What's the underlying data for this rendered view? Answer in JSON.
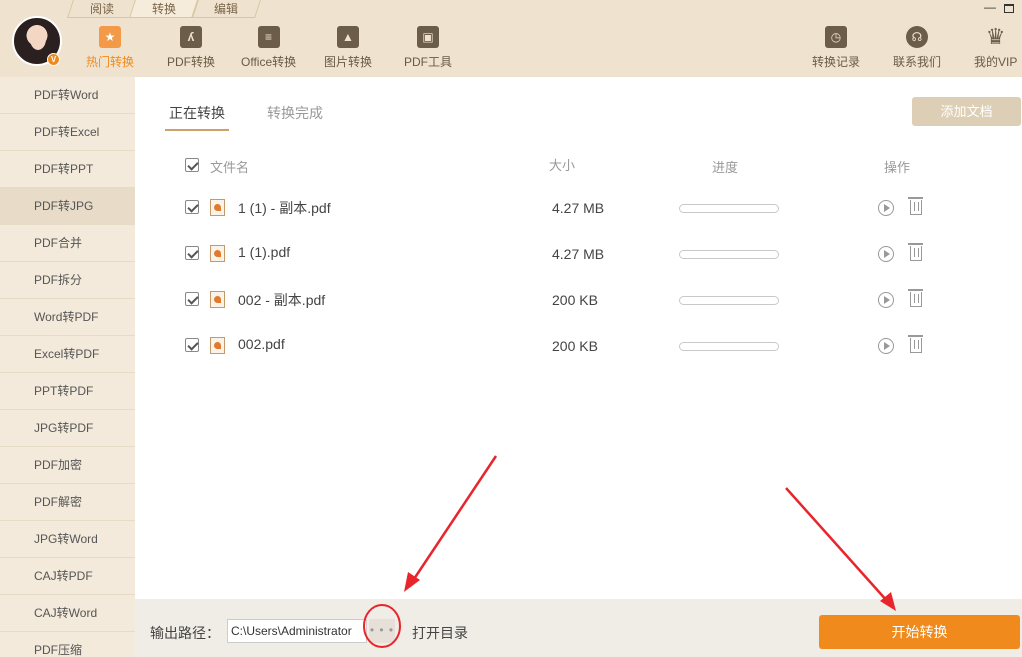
{
  "mode_tabs": [
    {
      "label": "阅读",
      "active": false
    },
    {
      "label": "转换",
      "active": true
    },
    {
      "label": "编辑",
      "active": false
    }
  ],
  "window_controls": {
    "minimize": "—",
    "maximize": ""
  },
  "avatar": {
    "badge": "V"
  },
  "toolbar": {
    "left": [
      {
        "label": "热门转换",
        "icon": "star-icon",
        "active": true
      },
      {
        "label": "PDF转换",
        "icon": "pdf-icon",
        "active": false
      },
      {
        "label": "Office转换",
        "icon": "office-doc-icon",
        "active": false
      },
      {
        "label": "图片转换",
        "icon": "image-icon",
        "active": false
      },
      {
        "label": "PDF工具",
        "icon": "toolbox-icon",
        "active": false
      }
    ],
    "right": [
      {
        "label": "转换记录",
        "icon": "clock-icon"
      },
      {
        "label": "联系我们",
        "icon": "headset-icon"
      },
      {
        "label": "我的VIP",
        "icon": "crown-icon"
      }
    ]
  },
  "sidebar": {
    "items": [
      {
        "label": "PDF转Word",
        "active": false
      },
      {
        "label": "PDF转Excel",
        "active": false
      },
      {
        "label": "PDF转PPT",
        "active": false
      },
      {
        "label": "PDF转JPG",
        "active": true
      },
      {
        "label": "PDF合并",
        "active": false
      },
      {
        "label": "PDF拆分",
        "active": false
      },
      {
        "label": "Word转PDF",
        "active": false
      },
      {
        "label": "Excel转PDF",
        "active": false
      },
      {
        "label": "PPT转PDF",
        "active": false
      },
      {
        "label": "JPG转PDF",
        "active": false
      },
      {
        "label": "PDF加密",
        "active": false
      },
      {
        "label": "PDF解密",
        "active": false
      },
      {
        "label": "JPG转Word",
        "active": false
      },
      {
        "label": "CAJ转PDF",
        "active": false
      },
      {
        "label": "CAJ转Word",
        "active": false
      },
      {
        "label": "PDF压缩",
        "active": false
      }
    ]
  },
  "main": {
    "tabs": [
      {
        "label": "正在转换",
        "active": true
      },
      {
        "label": "转换完成",
        "active": false
      }
    ],
    "add_button": "添加文档",
    "table": {
      "headers": {
        "name": "文件名",
        "size": "大小",
        "progress": "进度",
        "action": "操作"
      },
      "rows": [
        {
          "name": "1 (1) - 副本.pdf",
          "size": "4.27 MB",
          "progress": 0,
          "checked": true
        },
        {
          "name": "1 (1).pdf",
          "size": "4.27 MB",
          "progress": 0,
          "checked": true
        },
        {
          "name": "002 - 副本.pdf",
          "size": "200 KB",
          "progress": 0,
          "checked": true
        },
        {
          "name": "002.pdf",
          "size": "200 KB",
          "progress": 0,
          "checked": true
        }
      ]
    }
  },
  "bottom": {
    "output_label": "输出路径：",
    "output_path": "C:\\Users\\Administrator",
    "browse_label": "• • •",
    "open_dir_label": "打开目录",
    "start_label": "开始转换"
  },
  "colors": {
    "accent": "#f08a1d",
    "header_bg": "#efe3cf",
    "sidebar_bg": "#f3eadb",
    "annotation": "#e8252b"
  }
}
